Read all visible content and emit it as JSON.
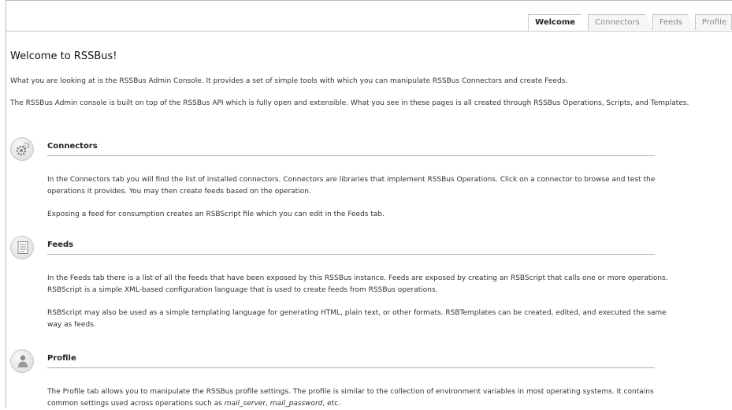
{
  "tabs": [
    {
      "label": "Welcome",
      "active": true
    },
    {
      "label": "Connectors",
      "active": false
    },
    {
      "label": "Feeds",
      "active": false
    },
    {
      "label": "Profile",
      "active": false
    }
  ],
  "page": {
    "title": "Welcome to RSSBus!",
    "intro1": "What you are looking at is the RSSBus Admin Console. It provides a set of simple tools with which you can manipulate RSSBus Connectors and create Feeds.",
    "intro2": "The RSSBus Admin console is built on top of the RSSBus API which is fully open and extensible. What you see in these pages is all created through RSSBus Operations, Scripts, and Templates."
  },
  "sections": {
    "connectors": {
      "icon": "gears-icon",
      "heading": "Connectors",
      "p1": "In the Connectors tab you will find the list of installed connectors. Connectors are libraries that implement RSSBus Operations. Click on a connector to browse and test the operations it provides. You may then create feeds based on the operation.",
      "p2": "Exposing a feed for consumption creates an RSBScript file which you can edit in the Feeds tab."
    },
    "feeds": {
      "icon": "document-icon",
      "heading": "Feeds",
      "p1": "In the Feeds tab there is a list of all the feeds that have been exposed by this RSSBus instance. Feeds are exposed by creating an RSBScript that calls one or more operations. RSBScript is a simple XML-based configuration language that is used to create feeds from RSSBus operations.",
      "p2": "RSBScript may also be used as a simple templating language for generating HTML, plain text, or other formats. RSBTemplates can be created, edited, and executed the same way as feeds."
    },
    "profile": {
      "icon": "user-icon",
      "heading": "Profile",
      "p1_start": "The Profile tab allows you to manipulate the RSSBus profile settings. The profile is similar to the collection of environment variables in most operating systems. It contains common settings used across operations such as ",
      "p1_em1": "mail_server",
      "p1_sep": ", ",
      "p1_em2": "mail_password",
      "p1_end": ", etc."
    }
  }
}
